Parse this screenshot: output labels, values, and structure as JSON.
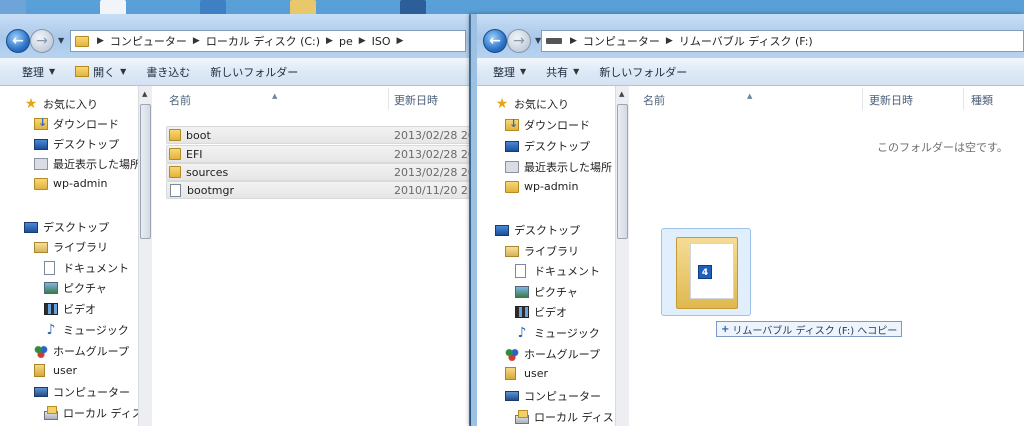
{
  "left_window": {
    "breadcrumb": [
      "コンピューター",
      "ローカル ディスク (C:)",
      "pe",
      "ISO"
    ],
    "toolbar": {
      "organize": "整理",
      "open": "開く",
      "burn": "書き込む",
      "new_folder": "新しいフォルダー"
    },
    "columns": {
      "name": "名前",
      "date": "更新日時"
    },
    "files": [
      {
        "name": "boot",
        "type": "folder",
        "date": "2013/02/28 20:"
      },
      {
        "name": "EFI",
        "type": "folder",
        "date": "2013/02/28 20:"
      },
      {
        "name": "sources",
        "type": "folder",
        "date": "2013/02/28 20:"
      },
      {
        "name": "bootmgr",
        "type": "file",
        "date": "2010/11/20 21:"
      }
    ]
  },
  "right_window": {
    "breadcrumb": [
      "コンピューター",
      "リムーバブル ディスク (F:)"
    ],
    "toolbar": {
      "organize": "整理",
      "share": "共有",
      "new_folder": "新しいフォルダー"
    },
    "columns": {
      "name": "名前",
      "date": "更新日時",
      "type": "種類"
    },
    "empty_message": "このフォルダーは空です。"
  },
  "nav": {
    "favorites": "お気に入り",
    "downloads": "ダウンロード",
    "desktop": "デスクトップ",
    "recent": "最近表示した場所",
    "wp_admin": "wp-admin",
    "desktop_root": "デスクトップ",
    "libraries": "ライブラリ",
    "documents": "ドキュメント",
    "pictures": "ピクチャ",
    "videos": "ビデオ",
    "music": "ミュージック",
    "homegroup": "ホームグループ",
    "user": "user",
    "computer": "コンピューター",
    "local_disk": "ローカル ディス"
  },
  "drag": {
    "count_badge": "4",
    "tooltip": "リムーバブル ディスク (F:) へコピー"
  },
  "colors": {
    "accent": "#2b74c8",
    "toolbar_bg": "#dde9f6",
    "selection": "#e6e6e6"
  }
}
